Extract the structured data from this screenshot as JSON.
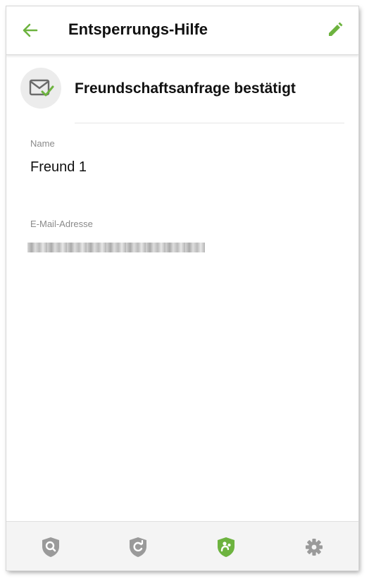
{
  "appbar": {
    "title": "Entsperrungs-Hilfe",
    "back_icon": "arrow-left-icon",
    "edit_icon": "pencil-icon"
  },
  "request": {
    "status": "Freundschaftsanfrage bestätigt",
    "status_icon": "mail-check-icon"
  },
  "fields": {
    "name_label": "Name",
    "name_value": "Freund 1",
    "email_label": "E-Mail-Adresse",
    "email_value": "●●●●●●●●●●●●@●●●●●.●●●"
  },
  "bottom_nav": {
    "items": [
      {
        "icon": "search-shield-icon",
        "active": false
      },
      {
        "icon": "refresh-shield-icon",
        "active": false
      },
      {
        "icon": "family-shield-icon",
        "active": true
      },
      {
        "icon": "gear-icon",
        "active": false
      }
    ]
  },
  "colors": {
    "accent": "#6db33f",
    "inactive_icon": "#9a9a9a",
    "text": "#111111",
    "label": "#8a8a8a"
  }
}
